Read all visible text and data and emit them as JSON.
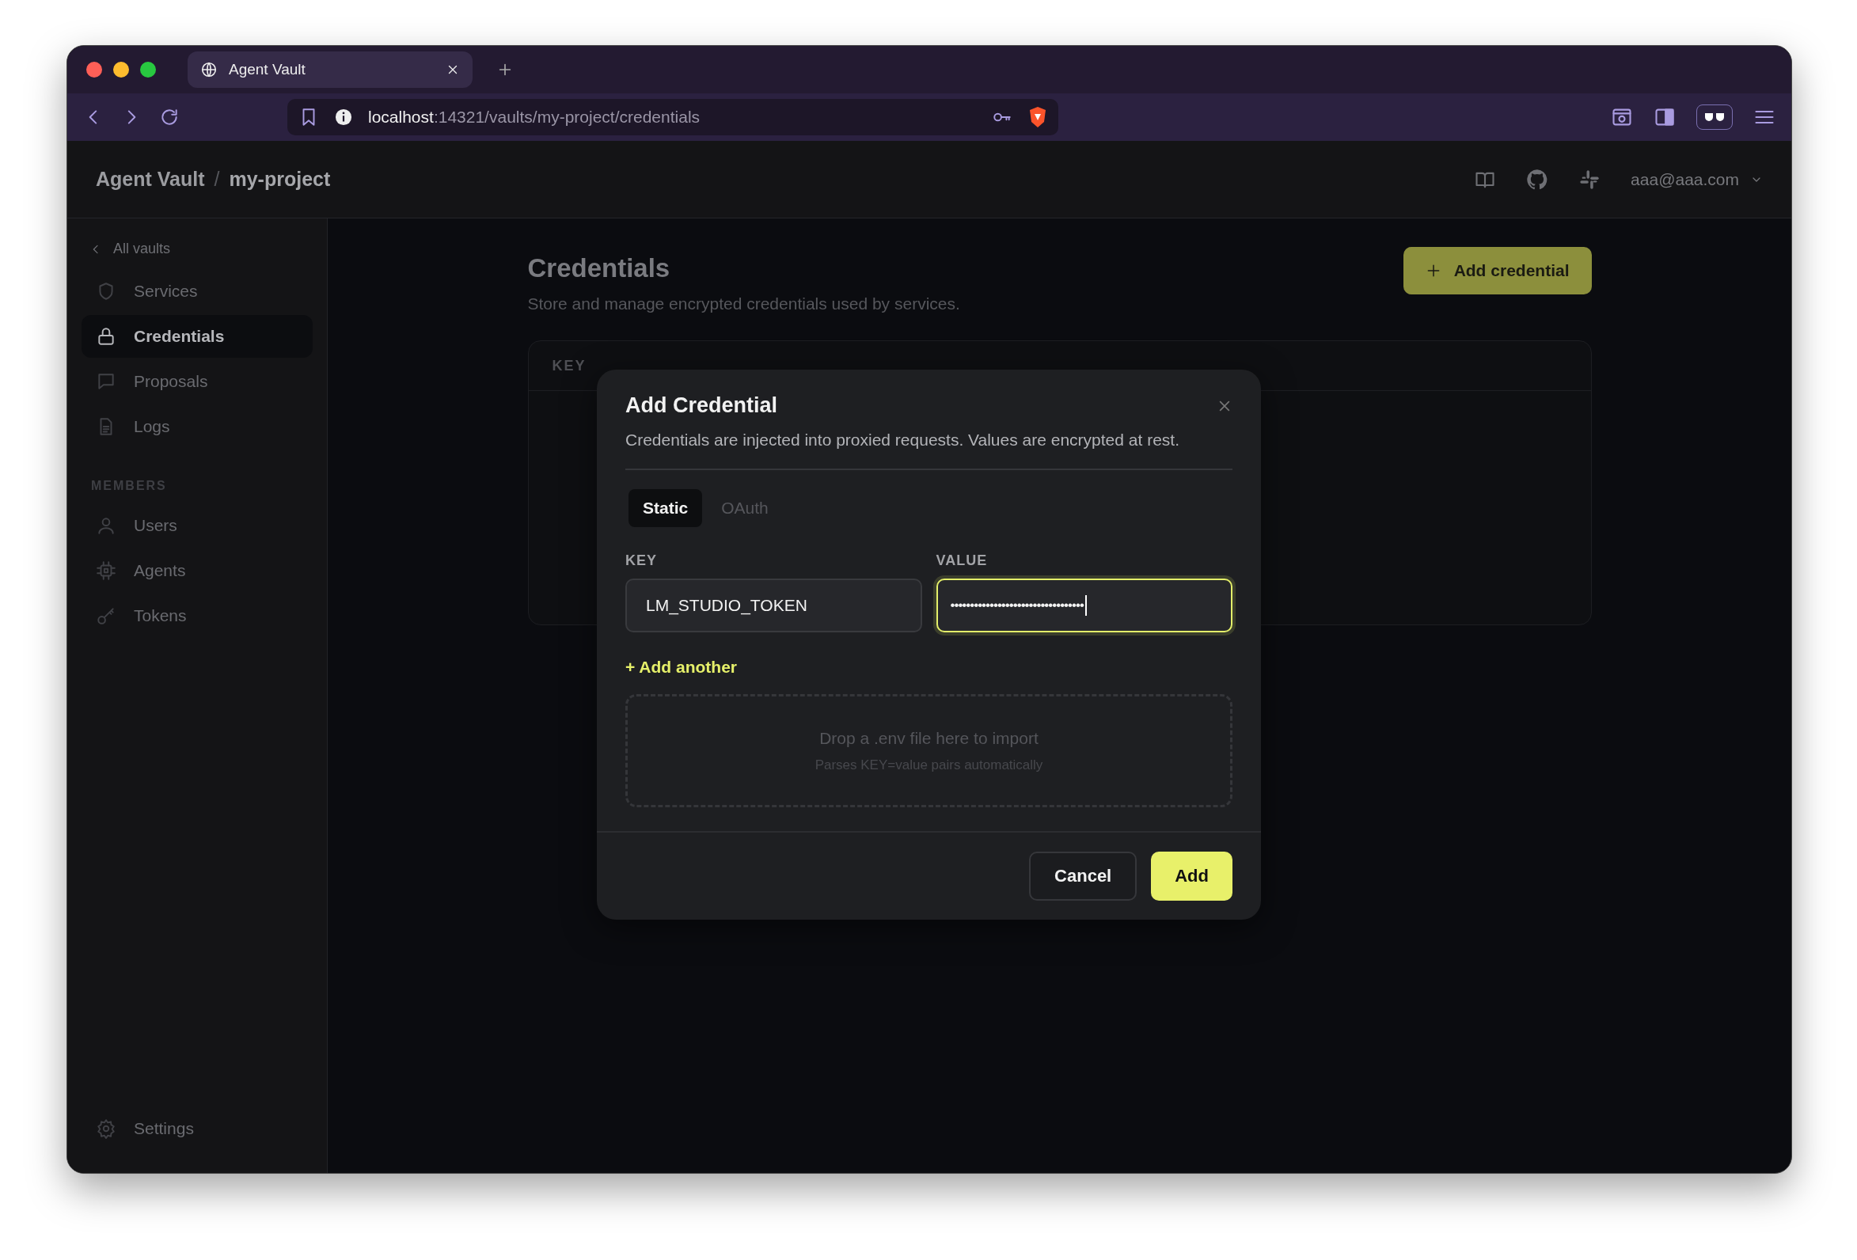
{
  "browser": {
    "tab": {
      "title": "Agent Vault"
    },
    "url": {
      "host": "localhost",
      "path": ":14321/vaults/my-project/credentials"
    }
  },
  "header": {
    "breadcrumb": [
      "Agent Vault",
      "my-project"
    ],
    "separator": "/",
    "user": "aaa@aaa.com"
  },
  "sidebar": {
    "back": "All vaults",
    "items": [
      {
        "label": "Services",
        "selected": false
      },
      {
        "label": "Credentials",
        "selected": true
      },
      {
        "label": "Proposals",
        "selected": false
      },
      {
        "label": "Logs",
        "selected": false
      }
    ],
    "section": {
      "title": "MEMBERS",
      "items": [
        {
          "label": "Users",
          "selected": false
        },
        {
          "label": "Agents",
          "selected": false
        },
        {
          "label": "Tokens",
          "selected": false
        }
      ]
    },
    "footer": {
      "label": "Settings"
    }
  },
  "page": {
    "title": "Credentials",
    "subtitle": "Store and manage encrypted credentials used by services.",
    "add_button": "Add credential",
    "table": {
      "columns": [
        "KEY"
      ]
    }
  },
  "dialog": {
    "title": "Add Credential",
    "description": "Credentials are injected into proxied requests. Values are encrypted at rest.",
    "tabs": [
      {
        "label": "Static",
        "selected": true
      },
      {
        "label": "OAuth",
        "selected": false
      }
    ],
    "fields": [
      {
        "label": "KEY",
        "value": "LM_STUDIO_TOKEN",
        "focused": false
      },
      {
        "label": "VALUE",
        "value": "••••••••••••••••••••••••••••••••••",
        "focused": true
      }
    ],
    "add_another": "+ Add another",
    "dropzone": {
      "title": "Drop a .env file here to import",
      "hint": "Parses KEY=value pairs automatically"
    },
    "buttons": [
      {
        "label": "Cancel",
        "kind": "secondary"
      },
      {
        "label": "Add",
        "kind": "primary"
      }
    ]
  }
}
